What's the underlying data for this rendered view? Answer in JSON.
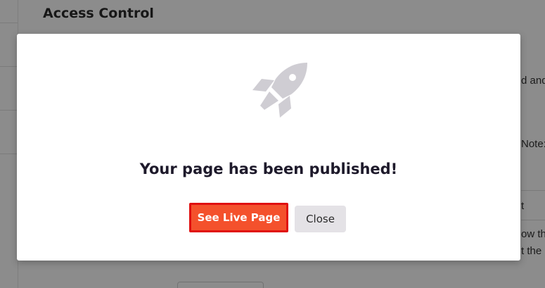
{
  "background": {
    "section_title": "Access Control",
    "text_fragments": [
      "d and",
      "Note:",
      "t",
      "ow th",
      "t the"
    ]
  },
  "modal": {
    "icon": "rocket-icon",
    "heading": "Your page has been published!",
    "primary_button_label": "See Live Page",
    "secondary_button_label": "Close"
  },
  "colors": {
    "primary_button": "#f4512c",
    "primary_button_border": "#e01010",
    "secondary_button": "#e4e2e6",
    "icon": "#cfcdd3",
    "heading_text": "#1e1a2b"
  }
}
